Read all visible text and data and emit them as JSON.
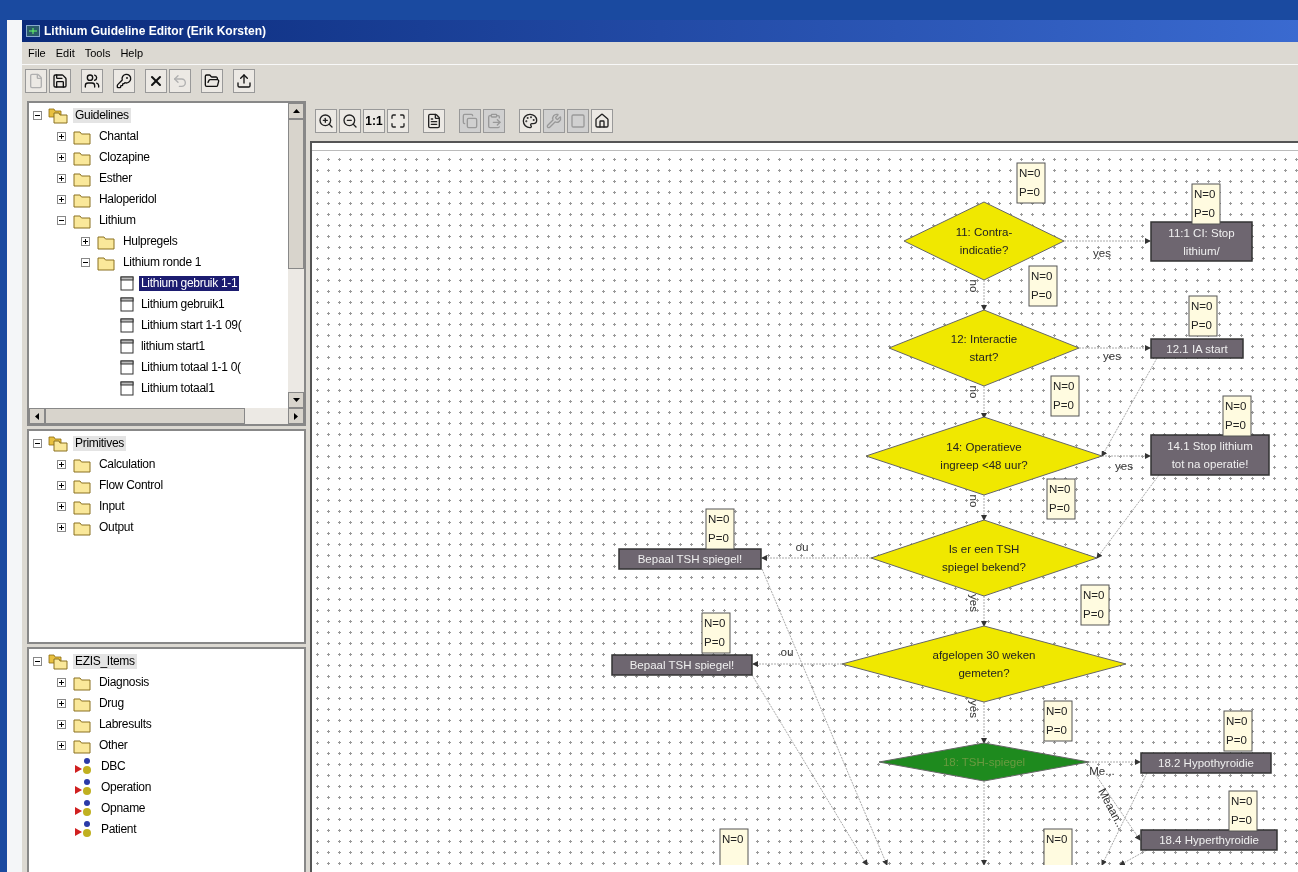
{
  "window": {
    "title": "Lithium Guideline Editor (Erik Korsten)"
  },
  "menu": [
    "File",
    "Edit",
    "Tools",
    "Help"
  ],
  "toolbar": [
    {
      "kind": "new",
      "disabled": true
    },
    {
      "kind": "save",
      "disabled": false
    },
    {
      "kind": "open",
      "disabled": false
    },
    {
      "kind": "key",
      "disabled": false
    },
    {
      "kind": "delete",
      "disabled": false
    },
    {
      "kind": "undo",
      "disabled": true
    },
    {
      "kind": "folder",
      "disabled": false
    },
    {
      "kind": "export",
      "disabled": false
    }
  ],
  "canvas_toolbar": [
    {
      "kind": "zoom-in",
      "disabled": false
    },
    {
      "kind": "zoom-out",
      "disabled": false
    },
    {
      "kind": "actual-size",
      "label": "1:1",
      "disabled": false
    },
    {
      "kind": "fit",
      "disabled": false
    },
    {
      "kind": "page",
      "disabled": false
    },
    {
      "kind": "copy",
      "disabled": true
    },
    {
      "kind": "paste",
      "disabled": true
    },
    {
      "kind": "palette",
      "disabled": false
    },
    {
      "kind": "tools",
      "disabled": true
    },
    {
      "kind": "fill",
      "disabled": true
    },
    {
      "kind": "home",
      "disabled": false
    }
  ],
  "trees": [
    {
      "label": "Guidelines",
      "kind": "group",
      "expanded": true,
      "selected": false,
      "children": [
        {
          "label": "Chantal",
          "kind": "folder",
          "expanded": false,
          "selected": false
        },
        {
          "label": "Clozapine",
          "kind": "folder",
          "expanded": false,
          "selected": false
        },
        {
          "label": "Esther",
          "kind": "folder",
          "expanded": false,
          "selected": false
        },
        {
          "label": "Haloperidol",
          "kind": "folder",
          "expanded": false,
          "selected": false
        },
        {
          "label": "Lithium",
          "kind": "folder",
          "expanded": true,
          "selected": false,
          "children": [
            {
              "label": "Hulpregels",
              "kind": "folder",
              "expanded": false,
              "selected": false
            },
            {
              "label": "Lithium ronde 1",
              "kind": "folder",
              "expanded": true,
              "selected": false,
              "children": [
                {
                  "label": "Lithium gebruik 1-1",
                  "kind": "document",
                  "selected": true
                },
                {
                  "label": "Lithium gebruik1",
                  "kind": "document",
                  "selected": false
                },
                {
                  "label": "Lithium start 1-1 09(",
                  "kind": "document",
                  "selected": false
                },
                {
                  "label": "lithium start1",
                  "kind": "document",
                  "selected": false
                },
                {
                  "label": "Lithium totaal 1-1 0(",
                  "kind": "document",
                  "selected": false
                },
                {
                  "label": "Lithium totaal1",
                  "kind": "document",
                  "selected": false
                }
              ]
            }
          ]
        }
      ]
    },
    {
      "label": "Primitives",
      "kind": "group",
      "expanded": true,
      "selected": false,
      "children": [
        {
          "label": "Calculation",
          "kind": "folder",
          "expanded": false,
          "selected": false
        },
        {
          "label": "Flow Control",
          "kind": "folder",
          "expanded": false,
          "selected": false
        },
        {
          "label": "Input",
          "kind": "folder",
          "expanded": false,
          "selected": false
        },
        {
          "label": "Output",
          "kind": "folder",
          "expanded": false,
          "selected": false
        }
      ]
    },
    {
      "label": "EZIS_Items",
      "kind": "group",
      "expanded": true,
      "selected": false,
      "children": [
        {
          "label": "Diagnosis",
          "kind": "folder",
          "expanded": false,
          "selected": false
        },
        {
          "label": "Drug",
          "kind": "folder",
          "expanded": false,
          "selected": false
        },
        {
          "label": "Labresults",
          "kind": "folder",
          "expanded": false,
          "selected": false
        },
        {
          "label": "Other",
          "kind": "folder",
          "expanded": false,
          "selected": false
        },
        {
          "label": "DBC",
          "kind": "item",
          "selected": false
        },
        {
          "label": "Operation",
          "kind": "item",
          "selected": false
        },
        {
          "label": "Opname",
          "kind": "item",
          "selected": false
        },
        {
          "label": "Patient",
          "kind": "item",
          "selected": false
        }
      ]
    }
  ],
  "flowchart": {
    "nodes": [
      {
        "kind": "decision",
        "color": "#f0e800",
        "lines": [
          "11: Contra-",
          "indicatie?"
        ]
      },
      {
        "kind": "action",
        "lines": [
          "11:1 CI: Stop",
          "lithium/"
        ]
      },
      {
        "kind": "decision",
        "color": "#f0e800",
        "lines": [
          "12: Interactie",
          "start?"
        ]
      },
      {
        "kind": "action",
        "lines": [
          "12.1 IA start"
        ]
      },
      {
        "kind": "decision",
        "color": "#f0e800",
        "lines": [
          "14: Operatieve",
          "ingreep <48 uur?"
        ]
      },
      {
        "kind": "action",
        "lines": [
          "14.1 Stop lithium",
          "tot na operatie!"
        ]
      },
      {
        "kind": "action",
        "lines": [
          "Bepaal TSH spiegel!"
        ]
      },
      {
        "kind": "decision",
        "color": "#f0e800",
        "lines": [
          "Is er een TSH",
          "spiegel bekend?"
        ]
      },
      {
        "kind": "action",
        "lines": [
          "Bepaal TSH spiegel!"
        ]
      },
      {
        "kind": "decision",
        "color": "#f0e800",
        "lines": [
          "afgelopen 30 weken",
          "gemeten?"
        ]
      },
      {
        "kind": "decision",
        "color": "#1e8a1e",
        "lines": [
          "18: TSH-spiegel"
        ]
      },
      {
        "kind": "action",
        "lines": [
          "18.2 Hypothyroidie"
        ]
      },
      {
        "kind": "action",
        "lines": [
          "18.4 Hyperthyroidie"
        ]
      }
    ],
    "edge_labels": [
      {
        "text": "yes",
        "kind": "horizontal"
      },
      {
        "text": "yes",
        "kind": "horizontal"
      },
      {
        "text": "yes",
        "kind": "horizontal"
      },
      {
        "text": "no",
        "kind": "vertical"
      },
      {
        "text": "no",
        "kind": "vertical"
      },
      {
        "text": "no",
        "kind": "vertical"
      },
      {
        "text": "no",
        "kind": "flipped"
      },
      {
        "text": "no",
        "kind": "flipped"
      },
      {
        "text": "yes",
        "kind": "vertical"
      },
      {
        "text": "yes",
        "kind": "vertical"
      },
      {
        "text": "Me...",
        "kind": "horizontal"
      },
      {
        "text": "Meaan...",
        "kind": "diagonal"
      }
    ],
    "counters": [
      {
        "lines": [
          "N=0",
          "P=0"
        ]
      },
      {
        "lines": [
          "N=0",
          "P=0"
        ]
      },
      {
        "lines": [
          "N=0",
          "P=0"
        ]
      },
      {
        "lines": [
          "N=0",
          "P=0"
        ]
      },
      {
        "lines": [
          "N=0",
          "P=0"
        ]
      },
      {
        "lines": [
          "N=0",
          "P=0"
        ]
      },
      {
        "lines": [
          "N=0",
          "P=0"
        ]
      },
      {
        "lines": [
          "N=0",
          "P=0"
        ]
      },
      {
        "lines": [
          "N=0",
          "P=0"
        ]
      },
      {
        "lines": [
          "N=0",
          "P=0"
        ]
      },
      {
        "lines": [
          "N=0",
          "P=0"
        ]
      },
      {
        "lines": [
          "N=0",
          "P=0"
        ]
      },
      {
        "lines": [
          "N=0",
          "P=0"
        ]
      },
      {
        "lines": [
          "N=0"
        ]
      },
      {
        "lines": [
          "N=0"
        ]
      }
    ]
  }
}
